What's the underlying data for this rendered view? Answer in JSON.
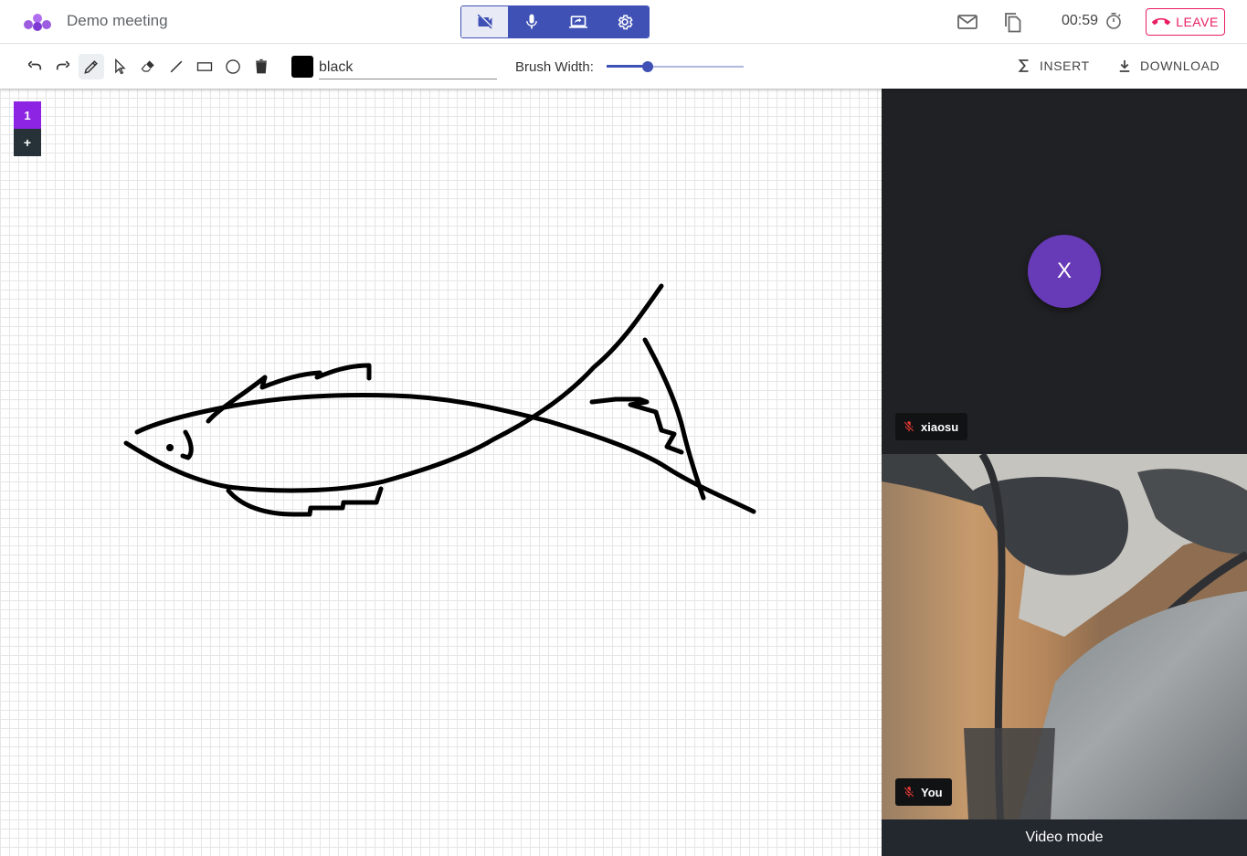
{
  "app": {
    "meeting_title": "Demo meeting",
    "logo_icon": "app-logo-icon"
  },
  "controls": {
    "camera": {
      "icon": "videocam-off-icon",
      "state": "off"
    },
    "microphone": {
      "icon": "mic-icon",
      "state": "on"
    },
    "screen_share": {
      "icon": "screen-share-icon"
    },
    "settings": {
      "icon": "gear-icon"
    }
  },
  "header_right": {
    "timer": "00:59",
    "leave_label": "LEAVE",
    "leave_color": "#e91e63"
  },
  "toolbar": {
    "tools": [
      "undo-icon",
      "redo-icon",
      "pencil-icon",
      "pointer-icon",
      "eraser-icon",
      "line-icon",
      "rectangle-icon",
      "circle-icon",
      "trash-icon"
    ],
    "active_tool": "pencil-icon",
    "color_value": "black",
    "color_swatch": "#000000",
    "brush_width_label": "Brush Width:",
    "brush_width_fraction": 0.3,
    "insert_label": "INSERT",
    "download_label": "DOWNLOAD"
  },
  "pages": {
    "current": "1",
    "add_label": "+"
  },
  "participants": {
    "remote": {
      "initial": "X",
      "name": "xiaosu",
      "avatar_color": "#673ab7"
    },
    "local": {
      "name": "You"
    }
  },
  "video_mode_label": "Video mode",
  "accent_color": "#3f51b5"
}
